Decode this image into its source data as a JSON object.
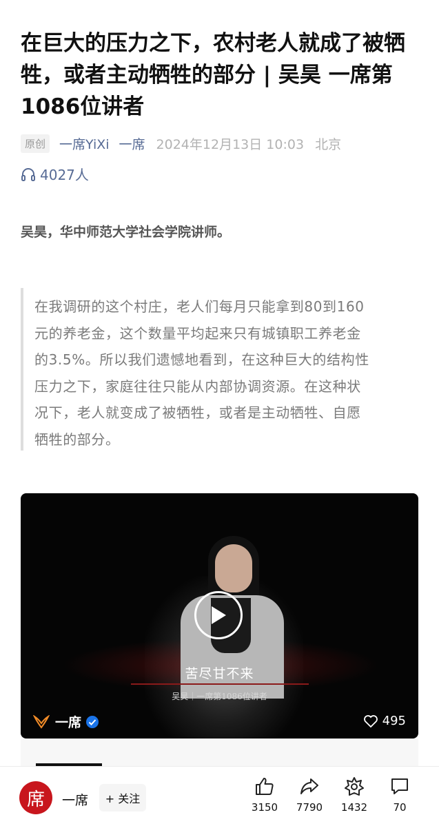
{
  "article": {
    "title": "在巨大的压力之下，农村老人就成了被牺牲，或者主动牺牲的部分 | 吴昊 一席第1086位讲者",
    "original_badge": "原创",
    "author": "一席YiXi",
    "account": "一席",
    "date": "2024年12月13日 10:03",
    "location": "北京",
    "listen_count": "4027人",
    "intro": "吴昊，华中师范大学社会学院讲师。",
    "quote_lines": [
      "在我调研的这个村庄，老人们每月只能拿到80到160",
      "元的养老金，这个数量平均起来只有城镇职工养老金",
      "的3.5%。所以我们遗憾地看到，在这种巨大的结构性",
      "压力之下，家庭往往只能从内部协调资源。在这种状",
      "况下，老人就变成了被牺牲，或者是主动牺牲、自愿",
      "牺牲的部分。"
    ]
  },
  "video": {
    "caption": "苦尽甘不来",
    "subcaption": "吴昊｜一席第1086位讲者",
    "brand": "一席",
    "likes": "495"
  },
  "bottom_bar": {
    "avatar_char": "席",
    "account_name": "一席",
    "follow_label": "+ 关注",
    "like_count": "3150",
    "share_count": "7790",
    "recommend_count": "1432",
    "comment_count": "70"
  },
  "colors": {
    "link_blue": "#576b95",
    "brand_red": "#c8161d",
    "verified_blue": "#1a73e8"
  },
  "icons": [
    "headphones-icon",
    "play-icon",
    "yixi-logo-icon",
    "verified-icon",
    "heart-icon",
    "thumbs-up-icon",
    "share-icon",
    "recommend-icon",
    "comment-icon"
  ]
}
